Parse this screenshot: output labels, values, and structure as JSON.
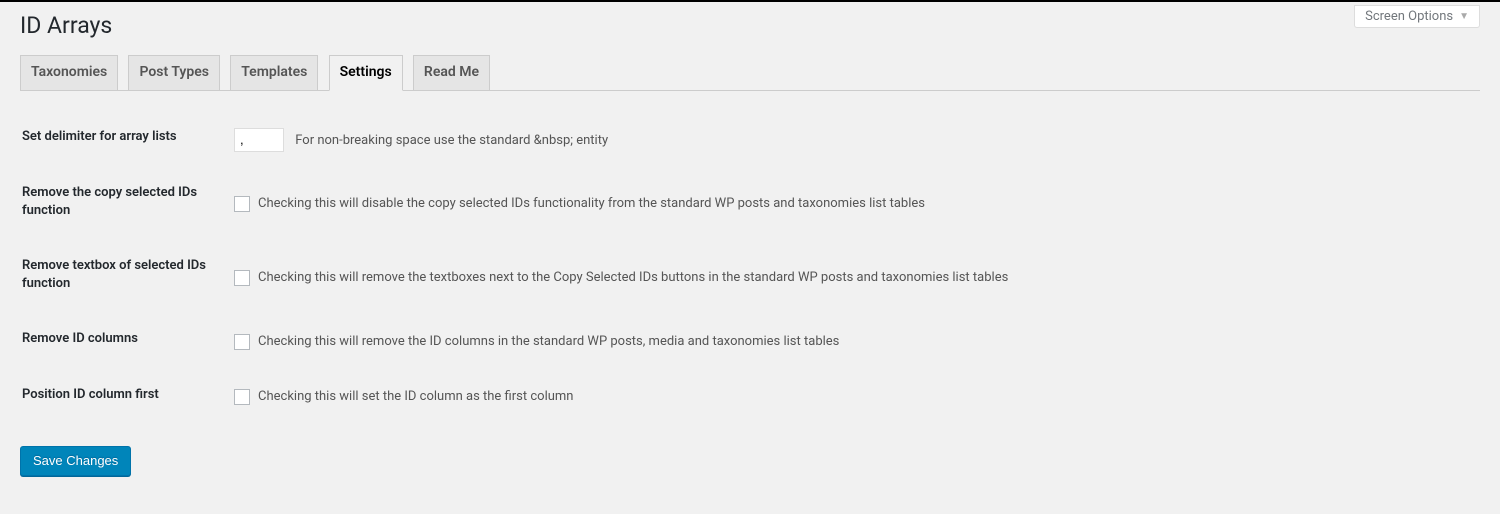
{
  "screen_options_label": "Screen Options",
  "page_title": "ID Arrays",
  "tabs": [
    {
      "label": "Taxonomies",
      "active": false
    },
    {
      "label": "Post Types",
      "active": false
    },
    {
      "label": "Templates",
      "active": false
    },
    {
      "label": "Settings",
      "active": true
    },
    {
      "label": "Read Me",
      "active": false
    }
  ],
  "settings": {
    "delimiter": {
      "label": "Set delimiter for array lists",
      "value": ",",
      "description": "For non-breaking space use the standard &nbsp; entity"
    },
    "remove_copy": {
      "label": "Remove the copy selected IDs function",
      "description": "Checking this will disable the copy selected IDs functionality from the standard WP posts and taxonomies list tables"
    },
    "remove_textbox": {
      "label": "Remove textbox of selected IDs function",
      "description": "Checking this will remove the textboxes next to the Copy Selected IDs buttons in the standard WP posts and taxonomies list tables"
    },
    "remove_id_columns": {
      "label": "Remove ID columns",
      "description": "Checking this will remove the ID columns in the standard WP posts, media and taxonomies list tables"
    },
    "position_first": {
      "label": "Position ID column first",
      "description": "Checking this will set the ID column as the first column"
    }
  },
  "save_button_label": "Save Changes"
}
